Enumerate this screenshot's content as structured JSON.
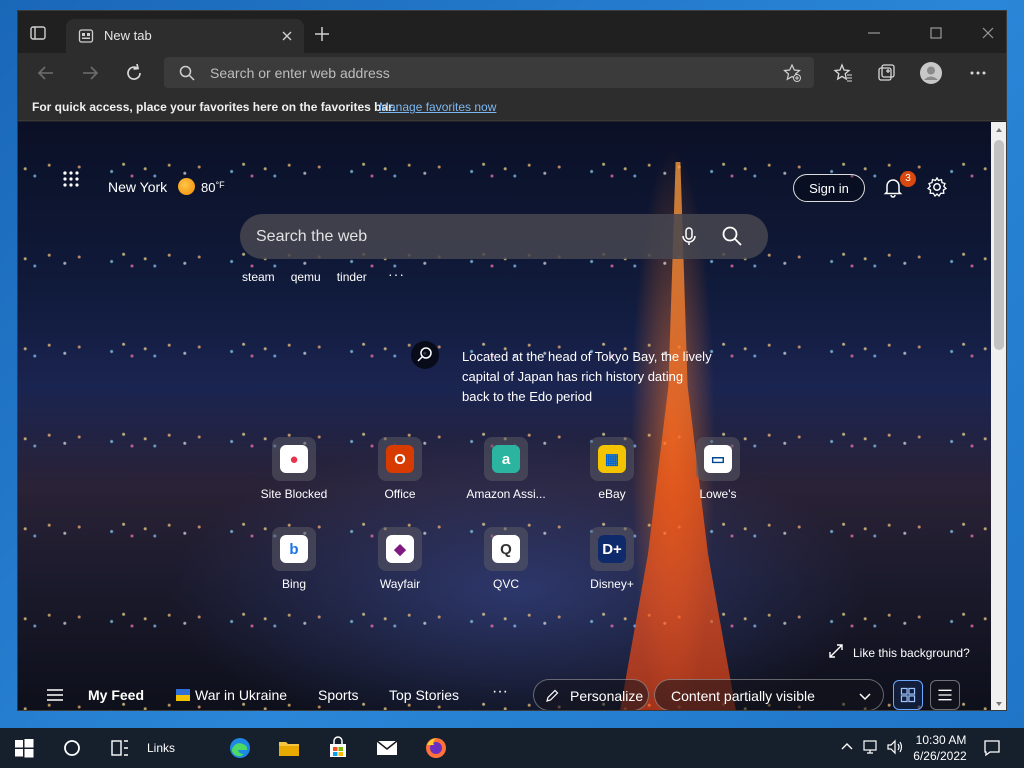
{
  "browser": {
    "tab": {
      "title": "New tab"
    },
    "address": {
      "placeholder": "Search or enter web address"
    },
    "favbar": {
      "text": "For quick access, place your favorites here on the favorites bar.",
      "link": "Manage favorites now"
    }
  },
  "page": {
    "weather": {
      "city": "New York",
      "temp": "80",
      "unit": "°F"
    },
    "signin_label": "Sign in",
    "notifications_count": "3",
    "search": {
      "placeholder": "Search the web"
    },
    "quick_links": [
      "steam",
      "qemu",
      "tinder"
    ],
    "quick_more": "···",
    "image_info": "Located at the head of Tokyo Bay, the lively capital of Japan has rich history dating back to the Edo period",
    "tiles": [
      {
        "label": "Site Blocked",
        "glyph": "●",
        "bg": "#ffffff",
        "fg": "#e8334a"
      },
      {
        "label": "Office",
        "glyph": "O",
        "bg": "#d83b01",
        "fg": "#ffffff"
      },
      {
        "label": "Amazon Assi...",
        "glyph": "a",
        "bg": "#2bb5a0",
        "fg": "#ffffff"
      },
      {
        "label": "eBay",
        "glyph": "▦",
        "bg": "#f5c400",
        "fg": "#0064d2"
      },
      {
        "label": "Lowe's",
        "glyph": "▭",
        "bg": "#ffffff",
        "fg": "#004990"
      },
      {
        "label": "Bing",
        "glyph": "b",
        "bg": "#ffffff",
        "fg": "#1a73e8"
      },
      {
        "label": "Wayfair",
        "glyph": "◆",
        "bg": "#ffffff",
        "fg": "#7f187f"
      },
      {
        "label": "QVC",
        "glyph": "Q",
        "bg": "#ffffff",
        "fg": "#333333"
      },
      {
        "label": "Disney+",
        "glyph": "D+",
        "bg": "#0f2a6b",
        "fg": "#ffffff"
      }
    ],
    "like_background": "Like this background?",
    "feed": {
      "my_feed": "My Feed",
      "war": "War in Ukraine",
      "sports": "Sports",
      "top_stories": "Top Stories",
      "more": "···",
      "personalize": "Personalize",
      "content_visibility": "Content partially visible"
    }
  },
  "taskbar": {
    "links_label": "Links",
    "time": "10:30 AM",
    "date": "6/26/2022"
  }
}
